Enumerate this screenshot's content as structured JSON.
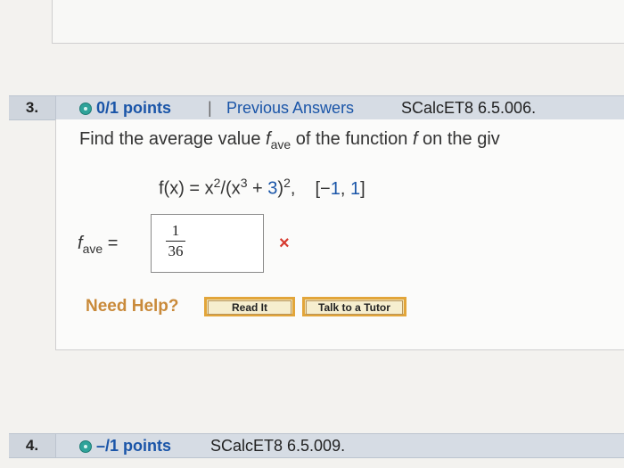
{
  "q3": {
    "number": "3.",
    "points": "0/1 points",
    "separator": "|",
    "previous_answers": "Previous Answers",
    "code": "SCalcET8 6.5.006.",
    "prompt_start": "Find the average value ",
    "f_ave_symbol": "f",
    "f_ave_sub": "ave",
    "prompt_mid": " of the function ",
    "f_symbol": "f",
    "prompt_end": " on the giv",
    "function_lhs": "f(x) = x",
    "exp1": "2",
    "function_mid": "/(x",
    "exp2": "3",
    "function_tail": " + ",
    "three": "3",
    "closing": ")",
    "exp3": "2",
    "comma": ",",
    "interval_open": "[−",
    "interval_a": "1",
    "interval_comma": ", ",
    "interval_b": "1",
    "interval_close": "]",
    "answer_label_f": "f",
    "answer_label_sub": "ave",
    "answer_equals": " =",
    "answer_numerator": "1",
    "answer_denominator": "36",
    "wrong_mark": "×",
    "need_help": "Need Help?",
    "read_it": "Read It",
    "talk_tutor": "Talk to a Tutor"
  },
  "q4": {
    "number": "4.",
    "points": "–/1 points",
    "code": "SCalcET8 6.5.009."
  }
}
